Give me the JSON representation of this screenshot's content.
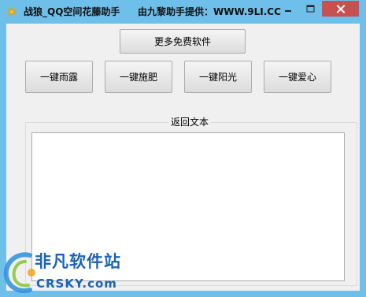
{
  "window": {
    "title": "战狼_QQ空间花藤助手",
    "provider": "由九黎助手提供：WWW.9LI.CC"
  },
  "toolbar": {
    "more_software": "更多免费软件"
  },
  "actions": [
    {
      "label": "一键雨露"
    },
    {
      "label": "一键施肥"
    },
    {
      "label": "一键阳光"
    },
    {
      "label": "一键爱心"
    }
  ],
  "output": {
    "group_label": "返回文本",
    "text": ""
  },
  "watermark": {
    "cn": "非凡软件站",
    "en": "CRSKY.com"
  },
  "colors": {
    "titlebar": "#6ec0eb",
    "close_button": "#c75050",
    "watermark": "#1d63b3"
  }
}
